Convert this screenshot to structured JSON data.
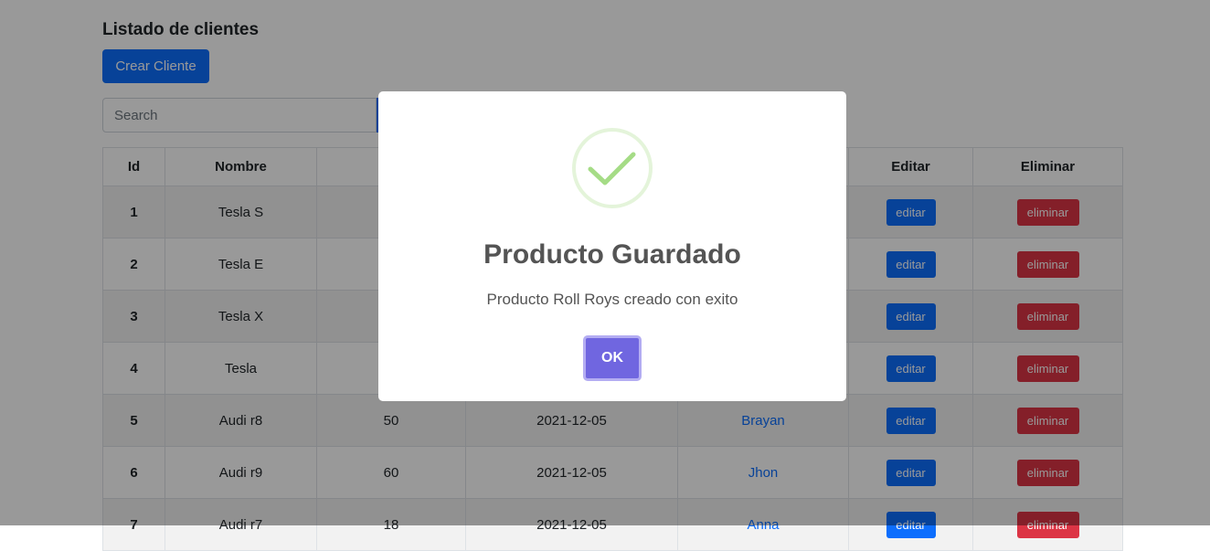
{
  "page": {
    "title": "Listado de clientes",
    "create_label": "Crear Cliente",
    "search": {
      "placeholder": "Search",
      "button_label": ""
    }
  },
  "table": {
    "headers": [
      "Id",
      "Nombre",
      "Ca",
      "",
      "",
      "Editar",
      "Eliminar"
    ],
    "rows": [
      {
        "id": "1",
        "nombre": "Tesla S",
        "cantidad": "",
        "fecha": "",
        "usuario": "",
        "edit": "editar",
        "delete": "eliminar"
      },
      {
        "id": "2",
        "nombre": "Tesla E",
        "cantidad": "",
        "fecha": "",
        "usuario": "",
        "edit": "editar",
        "delete": "eliminar"
      },
      {
        "id": "3",
        "nombre": "Tesla X",
        "cantidad": "",
        "fecha": "",
        "usuario": "",
        "edit": "editar",
        "delete": "eliminar"
      },
      {
        "id": "4",
        "nombre": "Tesla",
        "cantidad": "",
        "fecha": "",
        "usuario": "",
        "edit": "editar",
        "delete": "eliminar"
      },
      {
        "id": "5",
        "nombre": "Audi r8",
        "cantidad": "50",
        "fecha": "2021-12-05",
        "usuario": "Brayan",
        "edit": "editar",
        "delete": "eliminar"
      },
      {
        "id": "6",
        "nombre": "Audi r9",
        "cantidad": "60",
        "fecha": "2021-12-05",
        "usuario": "Jhon",
        "edit": "editar",
        "delete": "eliminar"
      },
      {
        "id": "7",
        "nombre": "Audi r7",
        "cantidad": "18",
        "fecha": "2021-12-05",
        "usuario": "Anna",
        "edit": "editar",
        "delete": "eliminar"
      }
    ]
  },
  "modal": {
    "icon": "success-check-icon",
    "title": "Producto Guardado",
    "message": "Producto Roll Roys creado con exito",
    "ok_label": "OK"
  },
  "colors": {
    "primary": "#0d6efd",
    "danger": "#dc3545",
    "confirm": "#7066e0",
    "success_icon": "#a5dc86"
  }
}
